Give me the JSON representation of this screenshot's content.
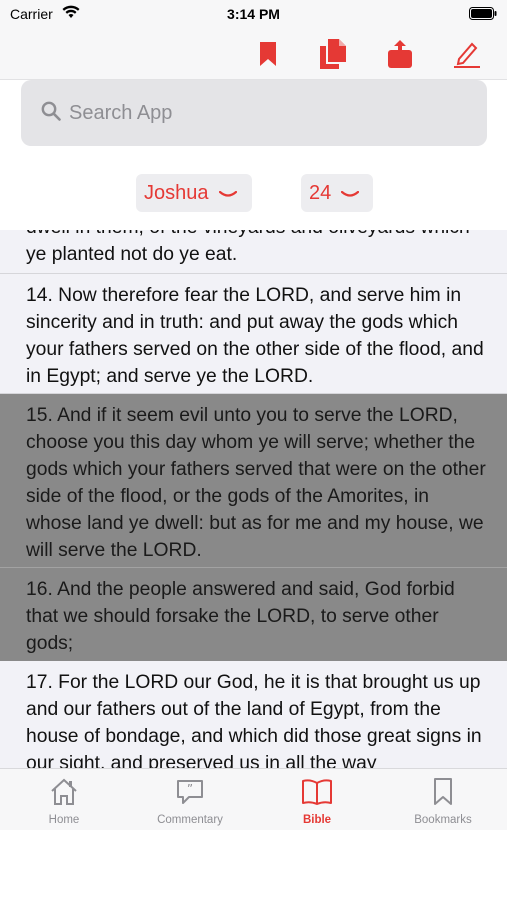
{
  "status": {
    "carrier": "Carrier",
    "time": "3:14 PM"
  },
  "toolbar": {
    "icons": [
      "bookmark-icon",
      "copy-icon",
      "share-icon",
      "edit-icon"
    ],
    "accent": "#e53935"
  },
  "search": {
    "placeholder": "Search App"
  },
  "selectors": {
    "book": "Joshua",
    "chapter": "24"
  },
  "verses": [
    {
      "text": "dwell in them, of the vineyards and oliveyards which ye planted not do ye eat."
    },
    {
      "text": "14. Now therefore fear the LORD, and serve him in sincerity and in truth: and put away the gods which your fathers served on the other side of the flood, and in Egypt; and serve ye the LORD."
    },
    {
      "text": "15. And if it seem evil unto you to serve the LORD, choose you this day whom ye will serve; whether the gods which your fathers served that were on the other side of the flood, or the gods of the Amorites, in whose land ye dwell: but as for me and my house, we will serve the LORD."
    },
    {
      "text": "16. And the people answered and said, God forbid that we should forsake the LORD, to serve other gods;"
    },
    {
      "text": "17. For the LORD our God, he it is that brought us up and our fathers out of the land of Egypt, from the house of bondage, and which did those great signs in our sight, and preserved us in all the way"
    }
  ],
  "tabs": [
    {
      "label": "Home",
      "icon": "home-icon"
    },
    {
      "label": "Commentary",
      "icon": "commentary-icon"
    },
    {
      "label": "Bible",
      "icon": "book-icon",
      "active": true
    },
    {
      "label": "Bookmarks",
      "icon": "bookmark-outline-icon"
    }
  ]
}
